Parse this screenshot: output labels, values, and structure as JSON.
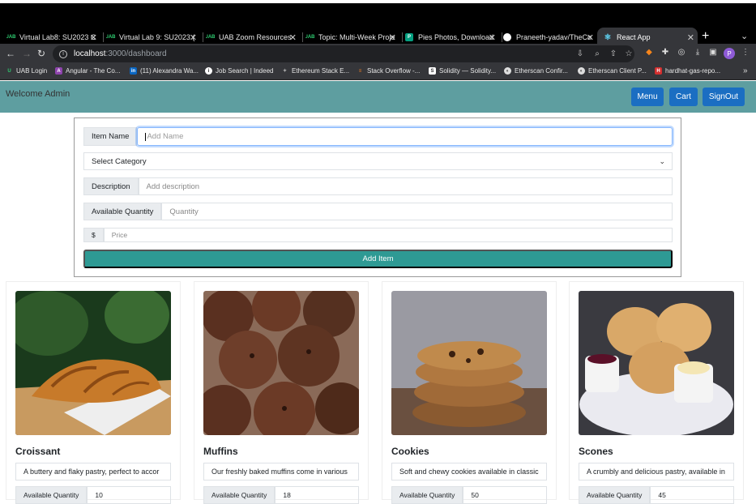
{
  "browser": {
    "tabs": [
      {
        "label": "Virtual Lab8: SU2023 C",
        "favicon": "uab-icon"
      },
      {
        "label": "Virtual Lab 9: SU2023 (",
        "favicon": "uab-icon"
      },
      {
        "label": "UAB Zoom Resources",
        "favicon": "uab-icon"
      },
      {
        "label": "Topic: Multi-Week Proje",
        "favicon": "uab-icon"
      },
      {
        "label": "Pies Photos, Download",
        "favicon": "pexels-icon"
      },
      {
        "label": "Praneeth-yadav/TheCo",
        "favicon": "github-icon"
      },
      {
        "label": "React App",
        "favicon": "react-icon"
      }
    ],
    "url_host": "localhost",
    "url_path": ":3000/dashboard",
    "profile_initial": "P",
    "bookmarks": [
      "UAB Login",
      "Angular - The Co...",
      "(11) Alexandra Wa...",
      "Job Search | Indeed",
      "Ethereum Stack E...",
      "Stack Overflow -...",
      "Solidity — Solidity...",
      "Etherscan Confir...",
      "Etherscan Client P...",
      "hardhat-gas-repo..."
    ]
  },
  "header": {
    "welcome": "Welcome Admin",
    "menu_label": "Menu",
    "cart_label": "Cart",
    "signout_label": "SignOut"
  },
  "form": {
    "item_name_label": "Item Name",
    "item_name_placeholder": "Add Name",
    "category_label": "Select Category",
    "description_label": "Description",
    "description_placeholder": "Add description",
    "quantity_label": "Available Quantity",
    "quantity_placeholder": "Quantity",
    "price_prefix": "$",
    "price_placeholder": "Price",
    "add_button_label": "Add Item"
  },
  "products": [
    {
      "name": "Croissant",
      "description": "A buttery and flaky pastry, perfect to accor",
      "qty_label": "Available Quantity",
      "qty": "10"
    },
    {
      "name": "Muffins",
      "description": "Our freshly baked muffins come in various",
      "qty_label": "Available Quantity",
      "qty": "18"
    },
    {
      "name": "Cookies",
      "description": "Soft and chewy cookies available in classic",
      "qty_label": "Available Quantity",
      "qty": "50"
    },
    {
      "name": "Scones",
      "description": "A crumbly and delicious pastry, available in",
      "qty_label": "Available Quantity",
      "qty": "45"
    }
  ],
  "colors": {
    "header_bg": "#5e9ea0",
    "nav_button": "#1b6ec2",
    "add_button": "#2e9a94"
  }
}
